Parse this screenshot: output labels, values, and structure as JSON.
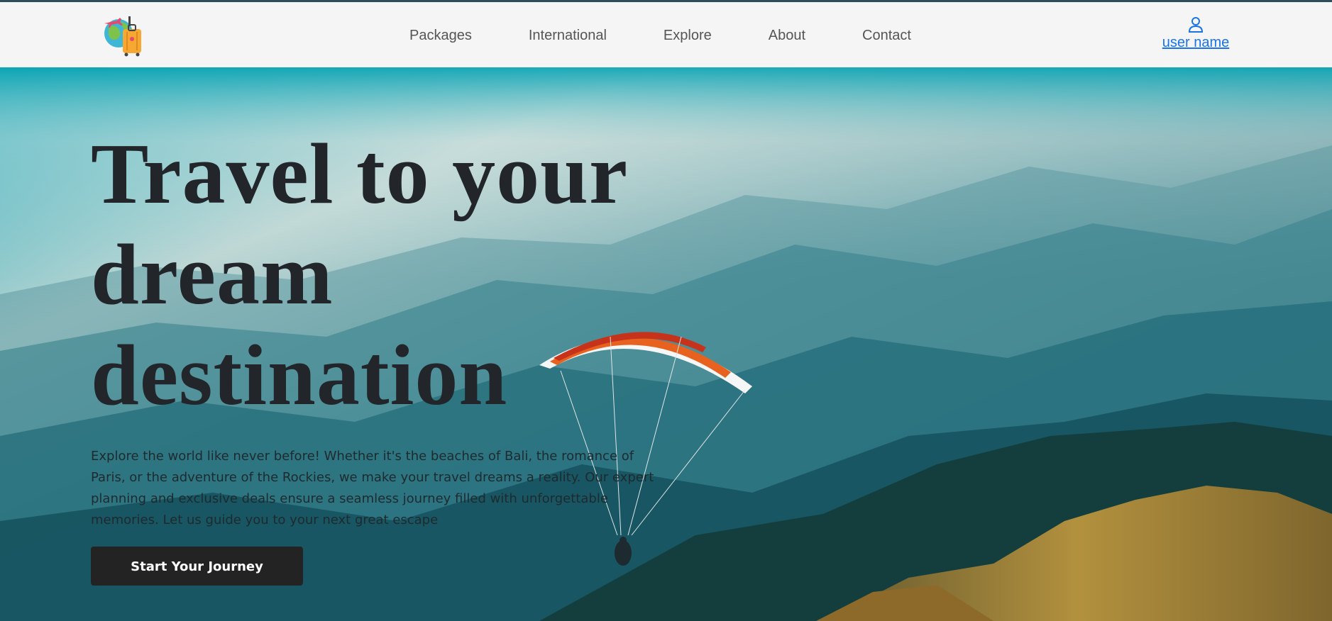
{
  "header": {
    "logo": "travel-suitcase-globe-logo",
    "nav": [
      {
        "label": "Packages"
      },
      {
        "label": "International"
      },
      {
        "label": "Explore"
      },
      {
        "label": "About"
      },
      {
        "label": "Contact"
      }
    ],
    "user": {
      "icon": "user-icon",
      "name": "user name"
    }
  },
  "hero": {
    "title_lines": [
      "Travel to your",
      "dream",
      "destination"
    ],
    "description": "Explore the world like never before! Whether it's the beaches of Bali, the romance of Paris, or the adventure of the Rockies, we make your travel dreams a reality. Our expert planning and exclusive deals ensure a seamless journey filled with unforgettable memories. Let us guide you to your next great escape",
    "cta_label": "Start Your Journey",
    "background": "paraglider-over-mountains-photo"
  },
  "colors": {
    "nav_bg": "#f5f5f5",
    "nav_text": "#555555",
    "user_link": "#1a73e8",
    "title_text": "#22252a",
    "cta_bg": "#232323",
    "cta_text": "#ffffff"
  }
}
